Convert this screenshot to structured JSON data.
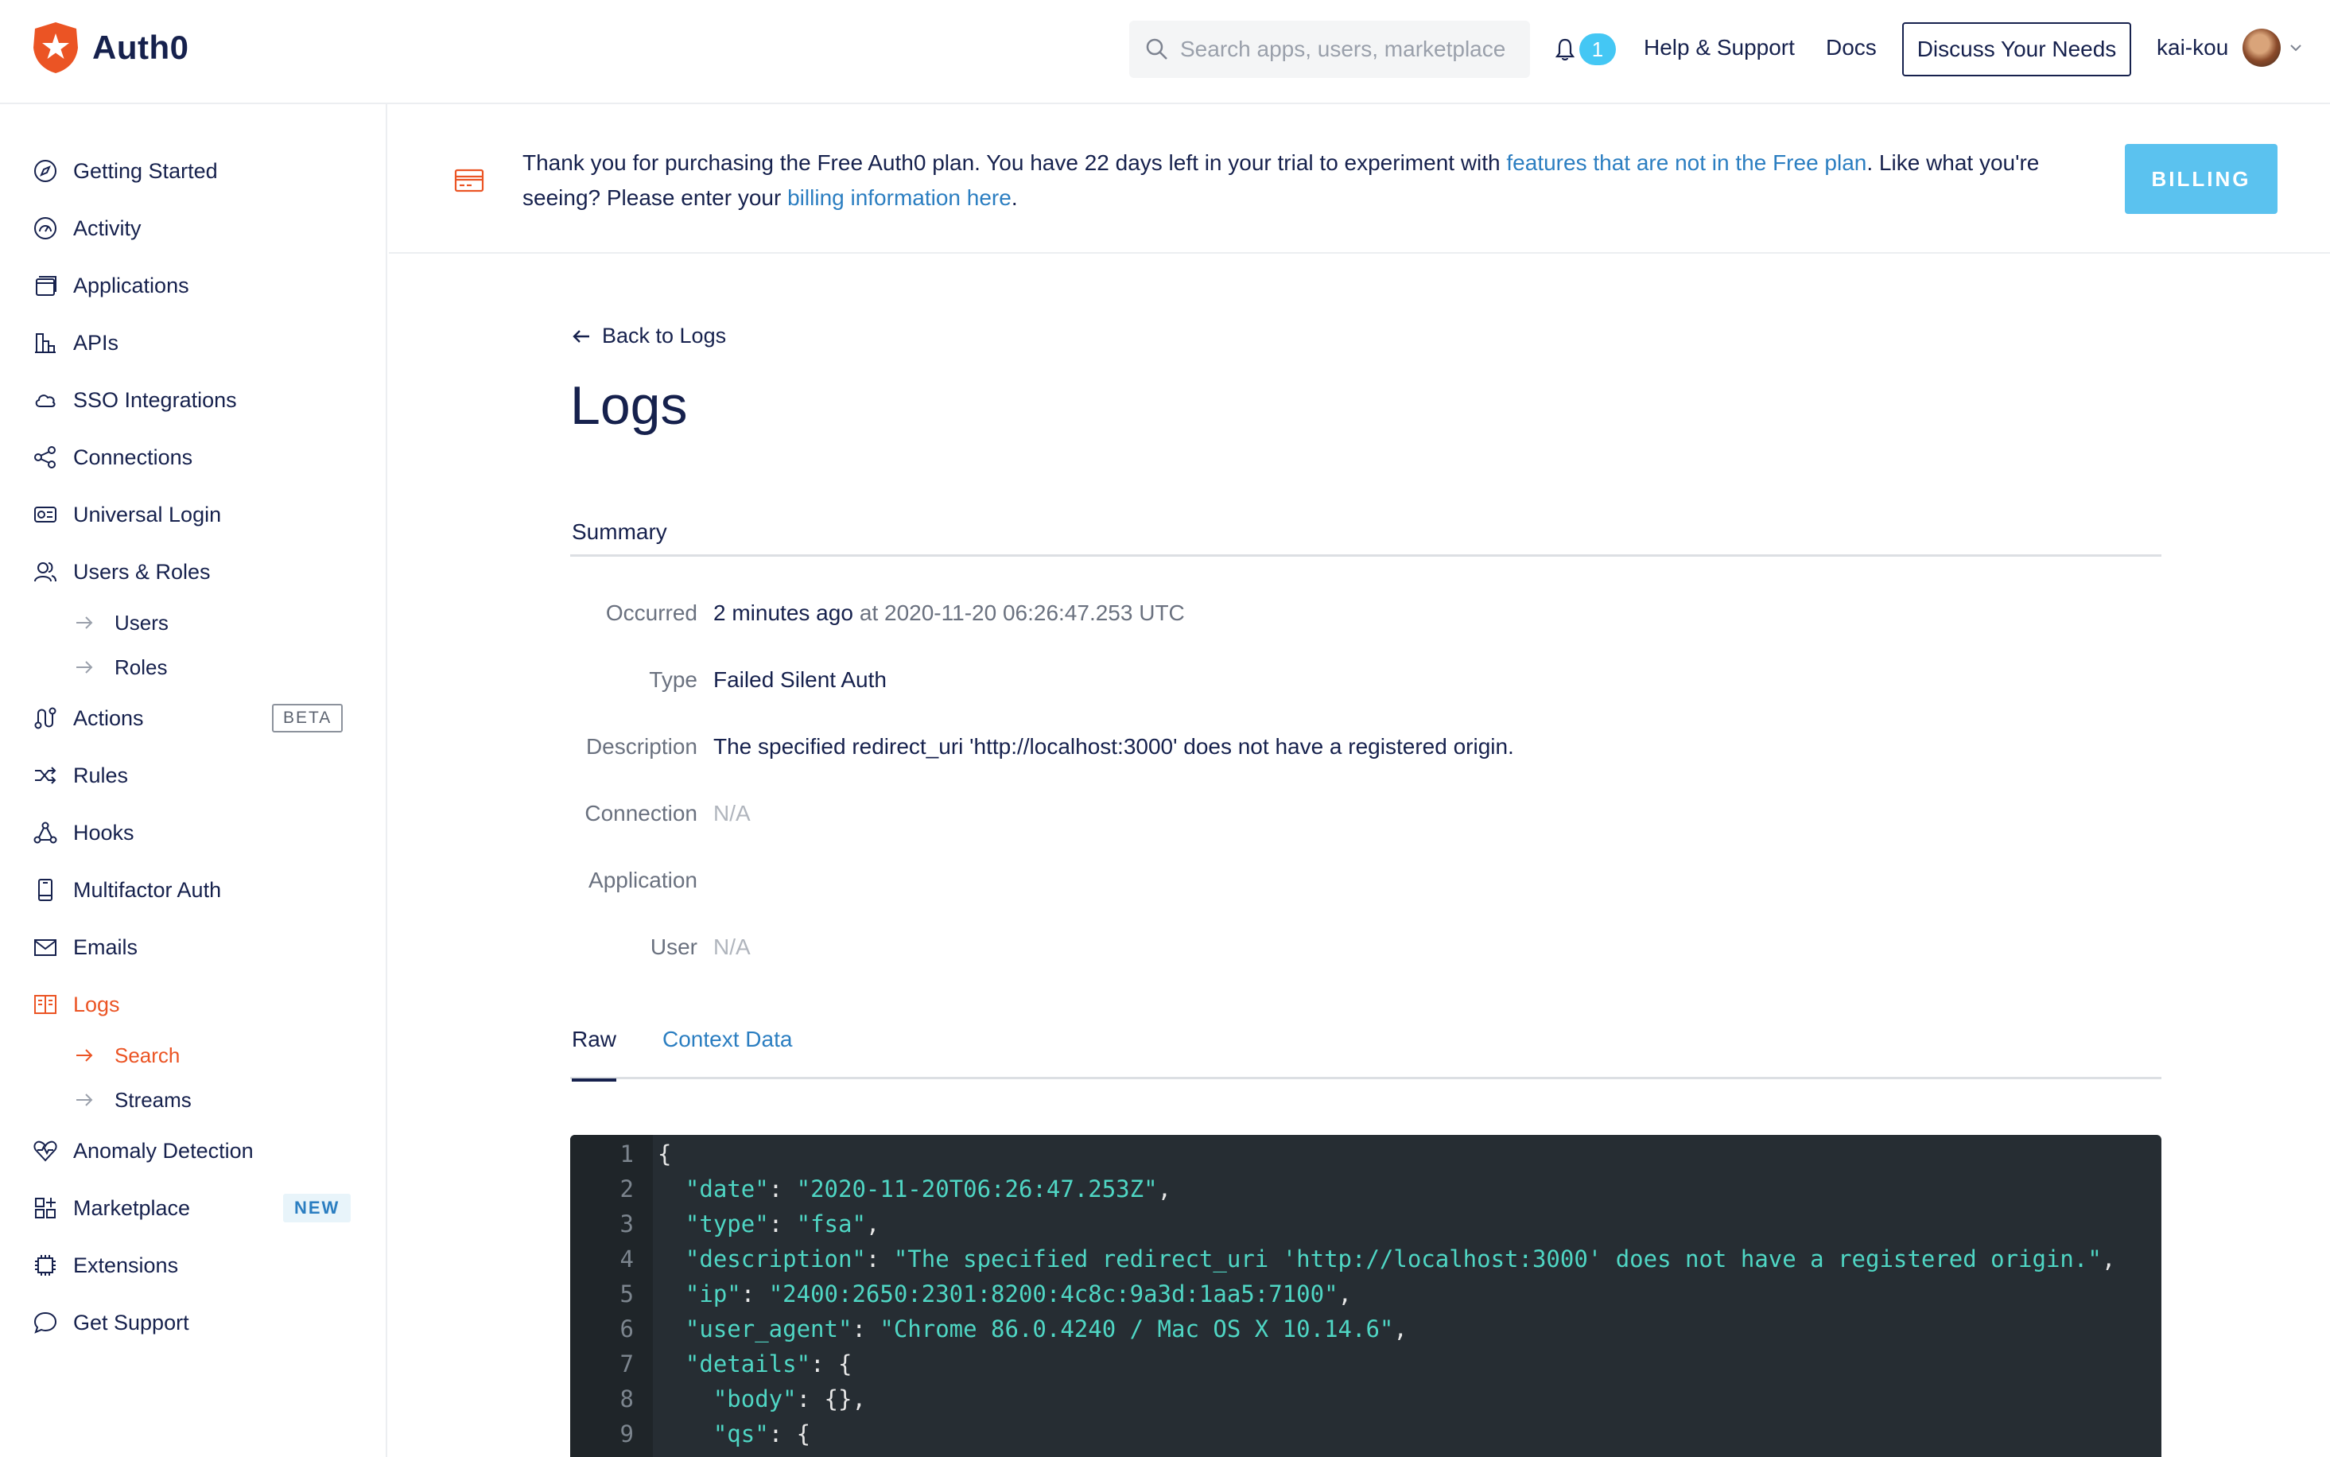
{
  "header": {
    "logo_text": "Auth0",
    "search_placeholder": "Search apps, users, marketplace",
    "notification_count": "1",
    "help_label": "Help & Support",
    "docs_label": "Docs",
    "discuss_label": "Discuss Your Needs",
    "username": "kai-kou"
  },
  "sidebar": {
    "items": [
      {
        "label": "Getting Started",
        "icon": "compass-icon"
      },
      {
        "label": "Activity",
        "icon": "gauge-icon"
      },
      {
        "label": "Applications",
        "icon": "window-stack-icon"
      },
      {
        "label": "APIs",
        "icon": "building-icon"
      },
      {
        "label": "SSO Integrations",
        "icon": "cloud-icon"
      },
      {
        "label": "Connections",
        "icon": "share-nodes-icon"
      },
      {
        "label": "Universal Login",
        "icon": "login-card-icon"
      },
      {
        "label": "Users & Roles",
        "icon": "users-icon"
      },
      {
        "label": "Actions",
        "icon": "flow-icon"
      },
      {
        "label": "Rules",
        "icon": "shuffle-icon"
      },
      {
        "label": "Hooks",
        "icon": "hook-icon"
      },
      {
        "label": "Multifactor Auth",
        "icon": "phone-icon"
      },
      {
        "label": "Emails",
        "icon": "envelope-icon"
      },
      {
        "label": "Logs",
        "icon": "book-icon"
      },
      {
        "label": "Anomaly Detection",
        "icon": "heart-pulse-icon"
      },
      {
        "label": "Marketplace",
        "icon": "grid-plus-icon"
      },
      {
        "label": "Extensions",
        "icon": "chip-icon"
      },
      {
        "label": "Get Support",
        "icon": "chat-icon"
      }
    ],
    "users_sub": [
      "Users",
      "Roles"
    ],
    "logs_sub": [
      "Search",
      "Streams"
    ],
    "beta_tag": "BETA",
    "new_tag": "NEW"
  },
  "banner": {
    "text_1": "Thank you for purchasing the Free Auth0 plan. You have 22 days left in your trial to experiment with ",
    "link_1": "features that are not in the Free plan",
    "text_2": ". Like what you're",
    "text_3": "seeing? Please enter your ",
    "link_2": "billing information here",
    "text_4": ".",
    "billing_label": "BILLING"
  },
  "main": {
    "back_label": "Back to Logs",
    "title": "Logs",
    "summary_heading": "Summary",
    "fields": {
      "occurred_label": "Occurred",
      "occurred_value": "2 minutes ago",
      "occurred_at": "at 2020-11-20 06:26:47.253 UTC",
      "type_label": "Type",
      "type_value": "Failed Silent Auth",
      "description_label": "Description",
      "description_value": "The specified redirect_uri 'http://localhost:3000' does not have a registered origin.",
      "connection_label": "Connection",
      "connection_value": "N/A",
      "application_label": "Application",
      "user_label": "User",
      "user_value": "N/A"
    },
    "tabs": [
      "Raw",
      "Context Data"
    ]
  },
  "code": {
    "lines": [
      {
        "n": "1",
        "text": "{"
      },
      {
        "n": "2",
        "key": "\"date\"",
        "val": "\"2020-11-20T06:26:47.253Z\"",
        "end": ",",
        "indent": "  "
      },
      {
        "n": "3",
        "key": "\"type\"",
        "val": "\"fsa\"",
        "end": ",",
        "indent": "  "
      },
      {
        "n": "4",
        "key": "\"description\"",
        "val": "\"The specified redirect_uri 'http://localhost:3000' does not have a registered origin.\"",
        "end": ",",
        "indent": "  "
      },
      {
        "n": "5",
        "key": "\"ip\"",
        "val": "\"2400:2650:2301:8200:4c8c:9a3d:1aa5:7100\"",
        "end": ",",
        "indent": "  "
      },
      {
        "n": "6",
        "key": "\"user_agent\"",
        "val": "\"Chrome 86.0.4240 / Mac OS X 10.14.6\"",
        "end": ",",
        "indent": "  "
      },
      {
        "n": "7",
        "key": "\"details\"",
        "val": "{",
        "end": "",
        "indent": "  "
      },
      {
        "n": "8",
        "key": "\"body\"",
        "val": "{}",
        "end": ",",
        "indent": "    "
      },
      {
        "n": "9",
        "key": "\"qs\"",
        "val": "{",
        "end": "",
        "indent": "    "
      }
    ]
  },
  "colors": {
    "brand": "#eb5424",
    "link": "#2b7ec1",
    "billing": "#5bc2ef",
    "code_bg": "#262d33",
    "code_token": "#4fd6c4"
  }
}
